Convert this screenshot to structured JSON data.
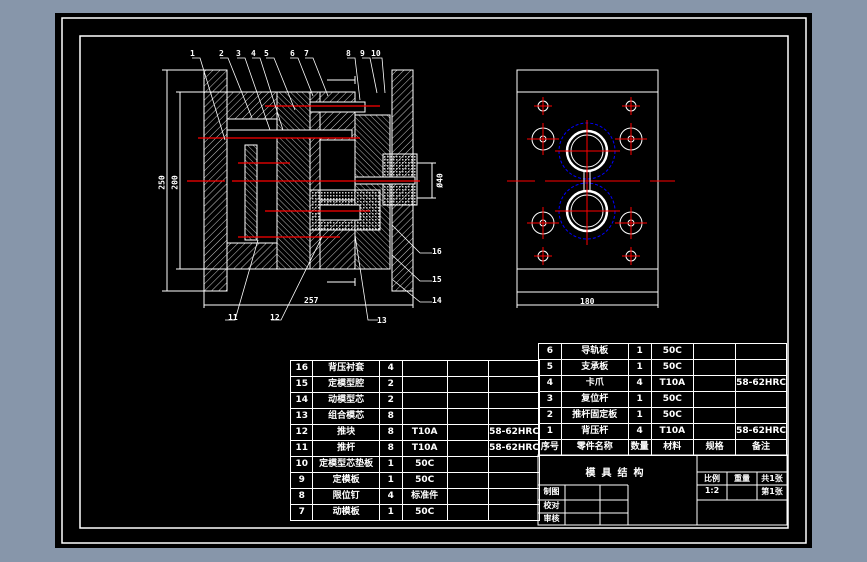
{
  "drawing": {
    "part_numbers": [
      "1",
      "2",
      "3",
      "4",
      "5",
      "6",
      "7",
      "8",
      "9",
      "10",
      "11",
      "12",
      "13",
      "14",
      "15",
      "16"
    ],
    "dimensions": {
      "overall_height": "250",
      "inner_height": "200",
      "overall_length": "257",
      "nozzle_diameter": "Ø40",
      "plate_width": "180"
    },
    "colors": {
      "background": "#000000",
      "lines": "#ffffff",
      "centerlines": "#ff0000",
      "hidden": "#0000ff",
      "canvas": "#8796aa"
    }
  },
  "parts_table_left": [
    {
      "no": "16",
      "name": "背压衬套",
      "qty": "4",
      "material": "",
      "spec": "",
      "note": ""
    },
    {
      "no": "15",
      "name": "定模型腔",
      "qty": "2",
      "material": "",
      "spec": "",
      "note": ""
    },
    {
      "no": "14",
      "name": "动模型芯",
      "qty": "2",
      "material": "",
      "spec": "",
      "note": ""
    },
    {
      "no": "13",
      "name": "组合模芯",
      "qty": "8",
      "material": "",
      "spec": "",
      "note": ""
    },
    {
      "no": "12",
      "name": "推块",
      "qty": "8",
      "material": "T10A",
      "spec": "",
      "note": "58-62HRC"
    },
    {
      "no": "11",
      "name": "推杆",
      "qty": "8",
      "material": "T10A",
      "spec": "",
      "note": "58-62HRC"
    },
    {
      "no": "10",
      "name": "定模型芯垫板",
      "qty": "1",
      "material": "50C",
      "spec": "",
      "note": ""
    },
    {
      "no": "9",
      "name": "定模板",
      "qty": "1",
      "material": "50C",
      "spec": "",
      "note": ""
    },
    {
      "no": "8",
      "name": "限位钉",
      "qty": "4",
      "material": "标准件",
      "spec": "",
      "note": ""
    },
    {
      "no": "7",
      "name": "动模板",
      "qty": "1",
      "material": "50C",
      "spec": "",
      "note": ""
    }
  ],
  "parts_table_right": [
    {
      "no": "6",
      "name": "导轨板",
      "qty": "1",
      "material": "50C",
      "spec": "",
      "note": ""
    },
    {
      "no": "5",
      "name": "支承板",
      "qty": "1",
      "material": "50C",
      "spec": "",
      "note": ""
    },
    {
      "no": "4",
      "name": "卡爪",
      "qty": "4",
      "material": "T10A",
      "spec": "",
      "note": "58-62HRC"
    },
    {
      "no": "3",
      "name": "复位杆",
      "qty": "1",
      "material": "50C",
      "spec": "",
      "note": ""
    },
    {
      "no": "2",
      "name": "推杆固定板",
      "qty": "1",
      "material": "50C",
      "spec": "",
      "note": ""
    },
    {
      "no": "1",
      "name": "背压杆",
      "qty": "4",
      "material": "T10A",
      "spec": "",
      "note": "58-62HRC"
    }
  ],
  "table_header": {
    "no": "序号",
    "name": "零件名称",
    "qty": "数量",
    "material": "材料",
    "spec": "规格",
    "note": "备注"
  },
  "title_block": {
    "title": "模具结构",
    "scale_label": "比例",
    "weight_label": "重量",
    "sheets_total": "共1张",
    "scale": "1:2",
    "sheet_no": "第1张",
    "drawn_by": "制图",
    "checked_by": "校对",
    "approved_by": "审核"
  }
}
